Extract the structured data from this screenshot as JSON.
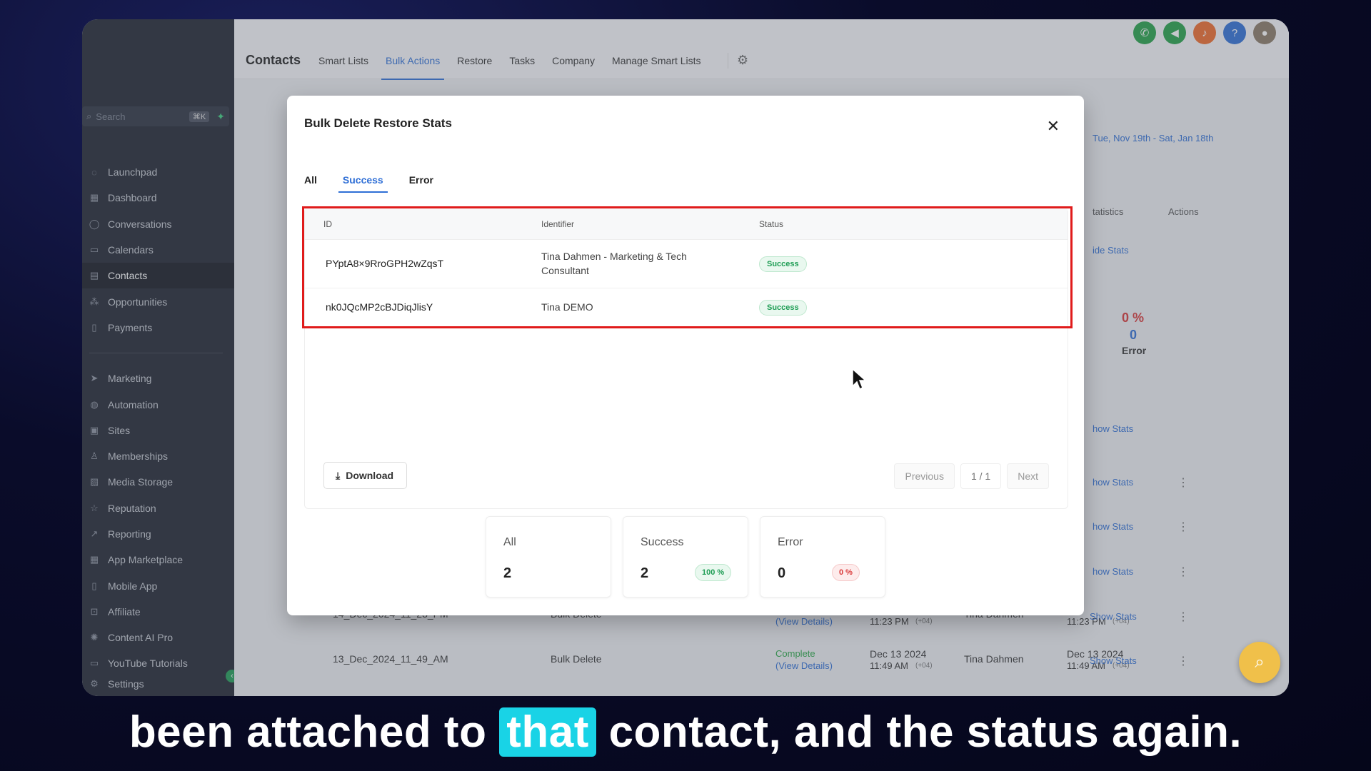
{
  "sidebar": {
    "search_placeholder": "Search",
    "search_shortcut": "⌘K",
    "items": [
      {
        "label": "Launchpad",
        "icon": "launchpad-icon"
      },
      {
        "label": "Dashboard",
        "icon": "dashboard-icon"
      },
      {
        "label": "Conversations",
        "icon": "chat-icon"
      },
      {
        "label": "Calendars",
        "icon": "calendar-icon"
      },
      {
        "label": "Contacts",
        "icon": "contacts-icon",
        "active": true
      },
      {
        "label": "Opportunities",
        "icon": "opportunities-icon"
      },
      {
        "label": "Payments",
        "icon": "payments-icon"
      }
    ],
    "items2": [
      {
        "label": "Marketing",
        "icon": "send-icon"
      },
      {
        "label": "Automation",
        "icon": "automation-icon"
      },
      {
        "label": "Sites",
        "icon": "sites-icon"
      },
      {
        "label": "Memberships",
        "icon": "memberships-icon"
      },
      {
        "label": "Media Storage",
        "icon": "media-icon"
      },
      {
        "label": "Reputation",
        "icon": "star-icon"
      },
      {
        "label": "Reporting",
        "icon": "reporting-icon"
      },
      {
        "label": "App Marketplace",
        "icon": "marketplace-icon"
      },
      {
        "label": "Mobile App",
        "icon": "mobile-icon"
      },
      {
        "label": "Affiliate",
        "icon": "affiliate-icon"
      },
      {
        "label": "Content AI Pro",
        "icon": "ai-icon"
      },
      {
        "label": "YouTube Tutorials",
        "icon": "youtube-icon"
      }
    ],
    "settings_label": "Settings"
  },
  "topbar": {
    "title": "Contacts",
    "tabs": [
      "Smart Lists",
      "Bulk Actions",
      "Restore",
      "Tasks",
      "Company",
      "Manage Smart Lists"
    ],
    "active_tab": "Bulk Actions"
  },
  "background": {
    "date_range": "Tue, Nov 19th - Sat, Jan 18th",
    "col_statistics": "tatistics",
    "col_actions": "Actions",
    "hide_stats": "ide Stats",
    "error_pct": "0 %",
    "error_count": "0",
    "error_label": "Error",
    "show_stats_partial": "how Stats",
    "show_stats": "Show Stats",
    "row1": {
      "name": "14_Dec_2024_11_23_PM",
      "action": "Bulk Delete",
      "view": "(View Details)",
      "time1": "11:23 PM",
      "tz": "(+04)",
      "user": "Tina Dahmen",
      "time2": "11:23 PM"
    },
    "row2": {
      "name": "13_Dec_2024_11_49_AM",
      "action": "Bulk Delete",
      "status": "Complete",
      "view": "(View Details)",
      "date1": "Dec 13 2024",
      "time1": "11:49 AM",
      "tz": "(+04)",
      "user": "Tina Dahmen",
      "date2": "Dec 13 2024",
      "time2": "11:49 AM"
    }
  },
  "modal": {
    "title": "Bulk Delete Restore Stats",
    "tabs": [
      "All",
      "Success",
      "Error"
    ],
    "active_tab": "Success",
    "columns": [
      "ID",
      "Identifier",
      "Status"
    ],
    "rows": [
      {
        "id": "PYptA8×9RroGPH2wZqsT",
        "identifier_line1": "Tina Dahmen - Marketing & Tech",
        "identifier_line2": "Consultant",
        "status": "Success"
      },
      {
        "id": "nk0JQcMP2cBJDiqJlisY",
        "identifier_line1": "Tina DEMO",
        "identifier_line2": "",
        "status": "Success"
      }
    ],
    "download_label": "Download",
    "pager": {
      "previous": "Previous",
      "page": "1 / 1",
      "next": "Next"
    },
    "stats": [
      {
        "label": "All",
        "value": "2",
        "pct": ""
      },
      {
        "label": "Success",
        "value": "2",
        "pct": "100 %"
      },
      {
        "label": "Error",
        "value": "0",
        "pct": "0 %"
      }
    ]
  },
  "caption": {
    "before": "been attached to ",
    "highlight": "that",
    "after": " contact, and the status again."
  },
  "colors": {
    "accent": "#2f6fd6",
    "success": "#1e9d54",
    "error": "#d93636",
    "highlight_box": "#e01b1b",
    "caption_highlight": "#19d3e6"
  }
}
